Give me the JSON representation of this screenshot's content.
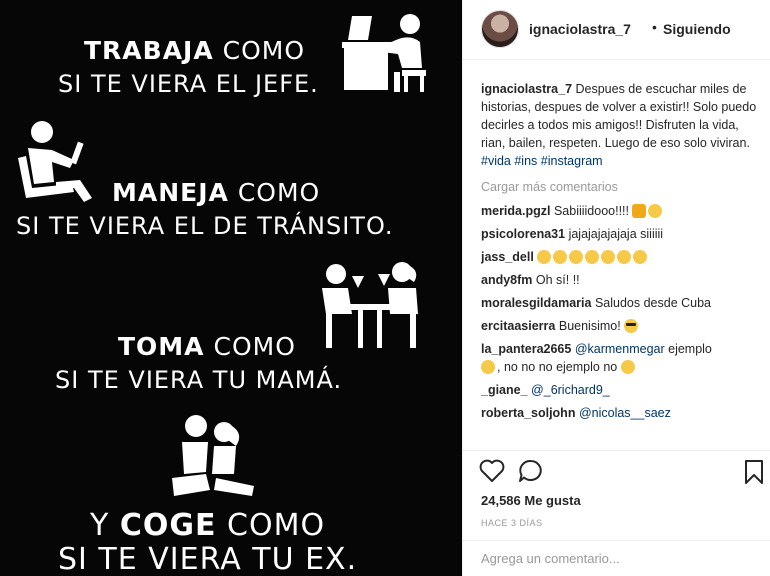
{
  "image": {
    "line1_bold": "TRABAJA",
    "line1_rest": " COMO",
    "line2": "SI TE VIERA EL JEFE.",
    "line3_bold": "MANEJA",
    "line3_rest": " COMO",
    "line4": "SI TE VIERA EL DE TRÁNSITO.",
    "line5_bold": "TOMA",
    "line5_rest": " COMO",
    "line6": "SI TE VIERA TU MAMÁ.",
    "line7_pre": "Y ",
    "line7_bold": "COGE",
    "line7_rest": " COMO",
    "line8": "SI TE VIERA TU EX."
  },
  "header": {
    "username": "ignaciolastra_7",
    "dot": "•",
    "follow_status": "Siguiendo"
  },
  "caption": {
    "username": "ignaciolastra_7",
    "text": "Despues de escuchar miles de historias, despues de volver a existir!! Solo puedo decirles a todos mis amigos!! Disfruten la vida, rian, bailen, respeten. Luego de eso solo viviran.",
    "tags": "#vida #ins #instagram"
  },
  "load_more": "Cargar más comentarios",
  "comments": [
    {
      "user": "merida.pgzl",
      "text": "Sabiiiidooo!!!! "
    },
    {
      "user": "psicolorena31",
      "text": "jajajajajajaja siiiiii"
    },
    {
      "user": "jass_dell",
      "text": ""
    },
    {
      "user": "andy8fm",
      "text": "Oh sí! !!"
    },
    {
      "user": "moralesgildamaria",
      "text": "Saludos desde Cuba"
    },
    {
      "user": "ercitaasierra",
      "text": "Buenisimo! "
    },
    {
      "user": "la_pantera2665",
      "mention": "@karmenmegar",
      "text": " ejemplo"
    },
    {
      "user": "",
      "text": ", no no no ejemplo no "
    },
    {
      "user": "_giane_",
      "mention": "@_6richard9_",
      "text": ""
    },
    {
      "user": "roberta_soljohn",
      "mention": "@nicolas__saez",
      "text": ""
    }
  ],
  "likes": "24,586 Me gusta",
  "time_ago": "HACE 3 DÍAS",
  "add_comment_placeholder": "Agrega un comentario...",
  "colors": {
    "link": "#003569",
    "muted": "#999999",
    "emoji": "#f7c948"
  }
}
